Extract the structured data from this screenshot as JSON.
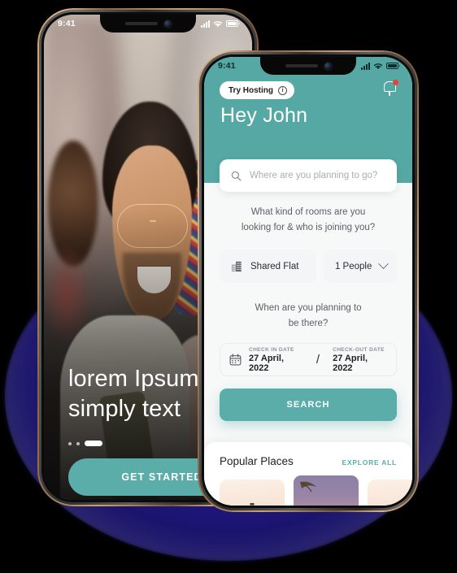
{
  "theme": {
    "accent": "#5aada8",
    "header_bg": "#55a8a4",
    "glow": "#241c8c",
    "notif_dot": "#ef3e36"
  },
  "back_phone": {
    "status_bar": {
      "time": "9:41",
      "signal_icon": "cellular-bars-icon",
      "wifi_icon": "wifi-icon",
      "battery_icon": "battery-icon"
    },
    "hero": {
      "title_line1": "lorem Ipsum",
      "title_line2": "simply text",
      "carousel_dots": 3,
      "active_dot_index": 2,
      "cta_label": "GET STARTED"
    }
  },
  "front_phone": {
    "status_bar": {
      "time": "9:41",
      "signal_icon": "cellular-bars-icon",
      "wifi_icon": "wifi-icon",
      "battery_icon": "battery-icon"
    },
    "header": {
      "try_hosting_label": "Try Hosting",
      "info_glyph": "i",
      "notification_icon": "bell-icon",
      "greeting": "Hey John"
    },
    "search": {
      "icon": "search-icon",
      "value": "",
      "placeholder": "Where are you planning to go?"
    },
    "rooms": {
      "question_line1": "What kind of rooms are you",
      "question_line2": "looking for & who is joining you?",
      "room_type_icon": "building-icon",
      "room_type_value": "Shared Flat",
      "people_value": "1 People",
      "people_chevron": "chevron-down-icon"
    },
    "dates": {
      "question_line1": "When are you planning to",
      "question_line2": "be there?",
      "calendar_icon": "calendar-icon",
      "check_in_label": "CHECK IN DATE",
      "check_in_value": "27 April, 2022",
      "separator": "/",
      "check_out_label": "CHECK-OUT DATE",
      "check_out_value": "27 April, 2022"
    },
    "search_button_label": "SEARCH",
    "popular": {
      "title": "Popular Places",
      "explore_all_label": "EXPLORE ALL",
      "cards": [
        {
          "name": "pagoda-sunrise-card"
        },
        {
          "name": "palm-dusk-card"
        },
        {
          "name": "pagoda-sunrise-card-2"
        }
      ]
    }
  }
}
